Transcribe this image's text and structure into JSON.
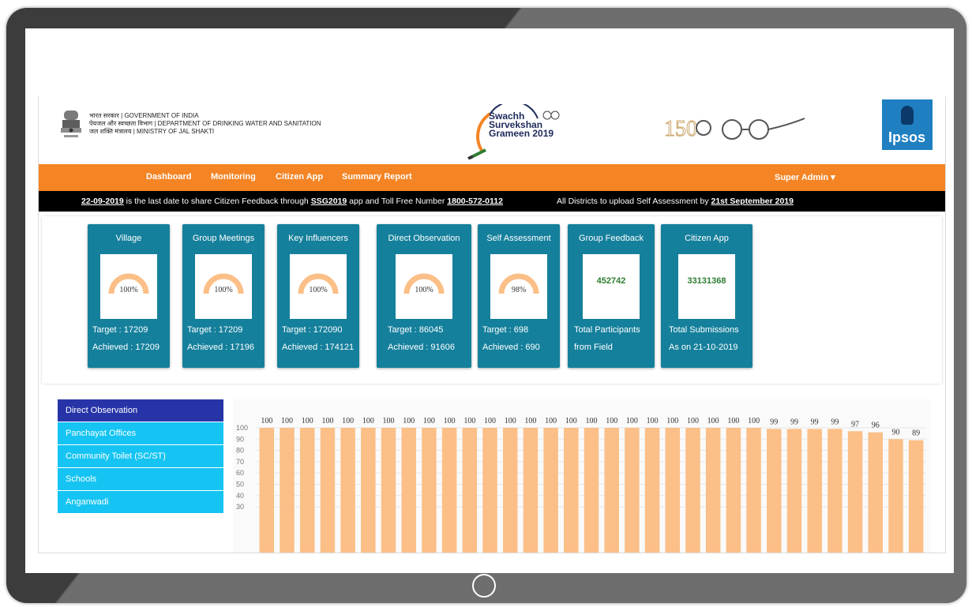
{
  "header": {
    "gov_line1": "भारत सरकार | GOVERNMENT OF INDIA",
    "gov_line2": "पेयजल और स्वच्छता विभाग | DEPARTMENT OF DRINKING WATER AND SANITATION",
    "gov_line3": "जल शक्ति मंत्रालय | MINISTRY OF JAL SHAKTI",
    "ssg_line1": "Swachh",
    "ssg_line2": "Survekshan",
    "ssg_line3": "Grameen 2019",
    "ipsos": "Ipsos"
  },
  "nav": {
    "items": [
      "Dashboard",
      "Monitoring",
      "Citizen App",
      "Summary Report"
    ],
    "user": "Super Admin",
    "color": "#f48424"
  },
  "ticker": {
    "date": "22-09-2019",
    "msg_a": " is the last date to share Citizen Feedback through ",
    "app": "SSG2019",
    "msg_b": " app and Toll Free Number ",
    "phone": "1800-572-0112",
    "msg2": "All Districts to upload Self Assessment by ",
    "deadline": "21st September 2019"
  },
  "tiles": [
    {
      "title": "Village",
      "value": "100%",
      "pct": 100,
      "line1": "Target : 17209",
      "line2": "Achieved : 17209"
    },
    {
      "title": "Group Meetings",
      "value": "100%",
      "pct": 100,
      "line1": "Target : 17209",
      "line2": "Achieved : 17196"
    },
    {
      "title": "Key Influencers",
      "value": "100%",
      "pct": 100,
      "line1": "Target : 172090",
      "line2": "Achieved : 174121"
    },
    {
      "title": "Direct Observation",
      "value": "100%",
      "pct": 100,
      "line1": "Target : 86045",
      "line2": "Achieved : 91606"
    },
    {
      "title": "Self Assessment",
      "value": "98%",
      "pct": 98,
      "line1": "Target : 698",
      "line2": "Achieved : 690"
    },
    {
      "title": "Group Feedback",
      "value": "452742",
      "line1": "Total Participants",
      "line2": "from Field"
    },
    {
      "title": "Citizen App",
      "value": "33131368",
      "line1": "Total Submissions",
      "line2": "As on 21-10-2019"
    }
  ],
  "sidebar": {
    "items": [
      "Direct Observation",
      "Panchayat Offices",
      "Community Toilet (SC/ST)",
      "Schools",
      "Anganwadi"
    ]
  },
  "chart_data": {
    "type": "bar",
    "title": "",
    "xlabel": "",
    "ylabel": "",
    "ylim": [
      0,
      100
    ],
    "yticks": [
      100,
      90,
      80,
      70,
      60,
      50,
      40,
      30
    ],
    "values": [
      100,
      100,
      100,
      100,
      100,
      100,
      100,
      100,
      100,
      100,
      100,
      100,
      100,
      100,
      100,
      100,
      100,
      100,
      100,
      100,
      100,
      100,
      100,
      100,
      100,
      99,
      99,
      99,
      99,
      97,
      96,
      90,
      89
    ],
    "bar_color": "#fbbf87",
    "label_color": "#333333"
  }
}
